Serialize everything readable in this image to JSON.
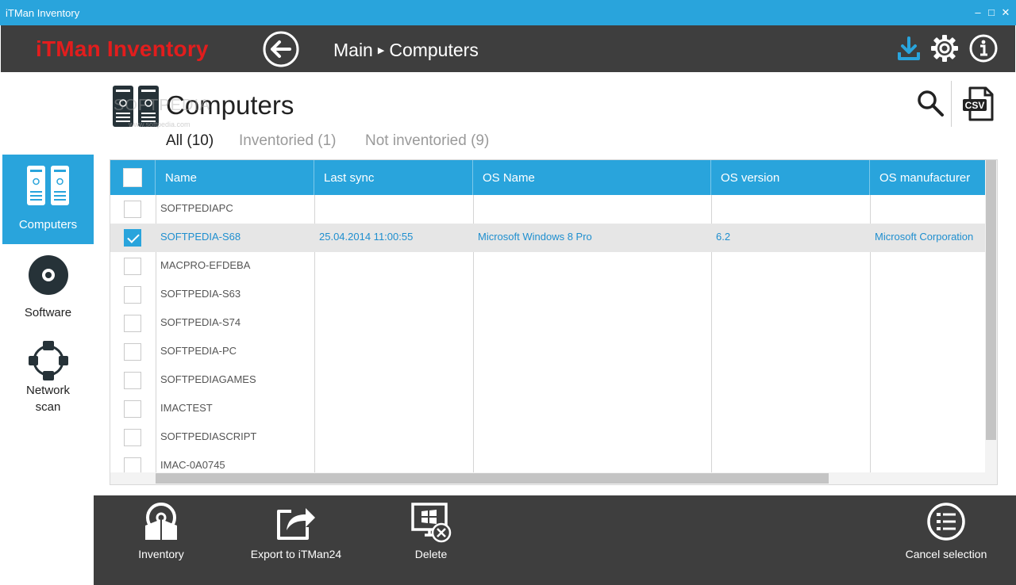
{
  "window": {
    "title": "iTMan Inventory",
    "minimize": "–",
    "maximize": "□",
    "close": "✕"
  },
  "header": {
    "app_title": "iTMan Inventory",
    "breadcrumb": [
      "Main",
      "Computers"
    ],
    "brand_color": "#e21d1d",
    "accent_color": "#29a4dc"
  },
  "sidebar": {
    "items": [
      {
        "label": "Computers",
        "icon": "computers-icon",
        "active": true
      },
      {
        "label": "Software",
        "icon": "disc-icon",
        "active": false
      },
      {
        "label": "Network scan",
        "label_lines": [
          "Network",
          "scan"
        ],
        "icon": "network-scan-icon",
        "active": false
      }
    ]
  },
  "main": {
    "title": "Computers",
    "watermark": "SOFTPEDIA",
    "watermark_url": "www.softpedia.com",
    "filters": [
      "All (10)",
      "Inventoried (1)",
      "Not inventoried (9)"
    ],
    "active_filter": 0
  },
  "table": {
    "columns": [
      "Name",
      "Last sync",
      "OS Name",
      "OS version",
      "OS manufacturer"
    ],
    "rows": [
      {
        "checked": false,
        "cells": [
          "SOFTPEDIAPC",
          "",
          "",
          "",
          ""
        ]
      },
      {
        "checked": true,
        "cells": [
          "SOFTPEDIA-S68",
          "25.04.2014 11:00:55",
          "Microsoft Windows 8 Pro",
          "6.2",
          "Microsoft Corporation"
        ]
      },
      {
        "checked": false,
        "cells": [
          "MACPRO-EFDEBA",
          "",
          "",
          "",
          ""
        ]
      },
      {
        "checked": false,
        "cells": [
          "SOFTPEDIA-S63",
          "",
          "",
          "",
          ""
        ]
      },
      {
        "checked": false,
        "cells": [
          "SOFTPEDIA-S74",
          "",
          "",
          "",
          ""
        ]
      },
      {
        "checked": false,
        "cells": [
          "SOFTPEDIA-PC",
          "",
          "",
          "",
          ""
        ]
      },
      {
        "checked": false,
        "cells": [
          "SOFTPEDIAGAMES",
          "",
          "",
          "",
          ""
        ]
      },
      {
        "checked": false,
        "cells": [
          "IMACTEST",
          "",
          "",
          "",
          ""
        ]
      },
      {
        "checked": false,
        "cells": [
          "SOFTPEDIASCRIPT",
          "",
          "",
          "",
          ""
        ]
      },
      {
        "checked": false,
        "cells": [
          "IMAC-0A0745",
          "",
          "",
          "",
          ""
        ]
      }
    ]
  },
  "toolbar": {
    "buttons": [
      {
        "label": "Inventory",
        "icon": "inventory-disc-icon"
      },
      {
        "label": "Export to iTMan24",
        "icon": "export-share-icon"
      },
      {
        "label": "Delete",
        "icon": "delete-computer-icon"
      },
      {
        "label": "Cancel selection",
        "icon": "cancel-selection-list-icon"
      }
    ]
  },
  "icons": {
    "download": "download-icon",
    "settings": "gear-icon",
    "info": "info-icon",
    "search": "search-icon",
    "csv": "csv-export-icon",
    "csv_text": "CSV"
  }
}
